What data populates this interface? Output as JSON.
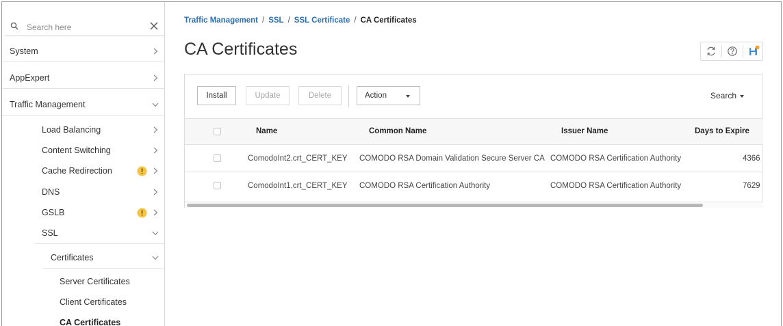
{
  "sidebar": {
    "search_placeholder": "Search here",
    "items": [
      {
        "label": "System",
        "icon": "chevron-right-icon"
      },
      {
        "label": "AppExpert",
        "icon": "chevron-right-icon"
      },
      {
        "label": "Traffic Management",
        "icon": "chevron-down-icon"
      },
      {
        "label": "Load Balancing",
        "icon": "chevron-right-icon"
      },
      {
        "label": "Content Switching",
        "icon": "chevron-right-icon"
      },
      {
        "label": "Cache Redirection",
        "icon": "chevron-right-icon",
        "warning": true
      },
      {
        "label": "DNS",
        "icon": "chevron-right-icon"
      },
      {
        "label": "GSLB",
        "icon": "chevron-right-icon",
        "warning": true
      },
      {
        "label": "SSL",
        "icon": "chevron-down-icon"
      },
      {
        "label": "Certificates",
        "icon": "chevron-down-icon"
      },
      {
        "label": "Server Certificates"
      },
      {
        "label": "Client Certificates"
      },
      {
        "label": "CA Certificates",
        "selected": true
      }
    ],
    "warning_color": "#f6c342"
  },
  "breadcrumb": {
    "items": [
      "Traffic Management",
      "SSL",
      "SSL Certificate"
    ],
    "current": "CA Certificates",
    "separator": "/"
  },
  "page": {
    "title": "CA Certificates"
  },
  "toolbar": {
    "install": "Install",
    "update": "Update",
    "delete": "Delete",
    "action": "Action",
    "search": "Search"
  },
  "table": {
    "columns": [
      "Name",
      "Common Name",
      "Issuer Name",
      "Days to Expire"
    ],
    "rows": [
      {
        "name": "ComodoInt2.crt_CERT_KEY",
        "common_name": "COMODO RSA Domain Validation Secure Server CA",
        "issuer": "COMODO RSA Certification Authority",
        "days": "4366"
      },
      {
        "name": "ComodoInt1.crt_CERT_KEY",
        "common_name": "COMODO RSA Certification Authority",
        "issuer": "COMODO RSA Certification Authority",
        "days": "7629"
      }
    ]
  },
  "colors": {
    "link": "#2b6fb0",
    "save_icon": "#3d8fd8",
    "save_dot": "#f0a030"
  }
}
